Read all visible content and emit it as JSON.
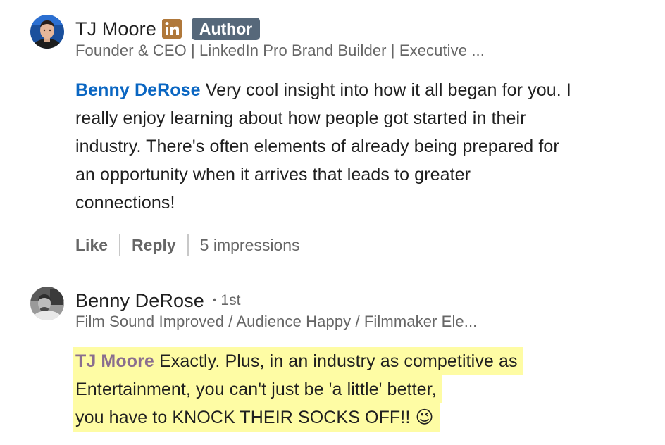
{
  "comments": [
    {
      "author": "TJ Moore",
      "author_badge": "Author",
      "linkedin_icon": "linkedin-icon",
      "headline": "Founder & CEO | LinkedIn Pro Brand Builder | Executive ...",
      "mention": "Benny DeRose",
      "text_lines": [
        "Very cool insight into how it all began for you. I",
        "really enjoy learning about how people got started in their",
        "industry. There's often elements of already being prepared for",
        "an opportunity when it arrives that leads to greater",
        "connections!"
      ],
      "actions": {
        "like": "Like",
        "reply": "Reply",
        "impressions": "5 impressions"
      }
    },
    {
      "author": "Benny DeRose",
      "degree_separator": "•",
      "degree": "1st",
      "headline": "Film Sound Improved / Audience Happy / Filmmaker Ele...",
      "mention": "TJ Moore",
      "text_lines": [
        "Exactly. Plus, in an industry as competitive as",
        "Entertainment, you can't just be 'a little' better,",
        "you have to KNOCK THEIR SOCKS OFF!! 😉"
      ]
    }
  ],
  "colors": {
    "mention_blue": "#0a66c2",
    "mention_mauve": "#8a6e8f",
    "highlight_yellow": "#fefca4",
    "author_badge_bg": "#56687a",
    "linkedin_icon_bg": "#b0783a"
  }
}
